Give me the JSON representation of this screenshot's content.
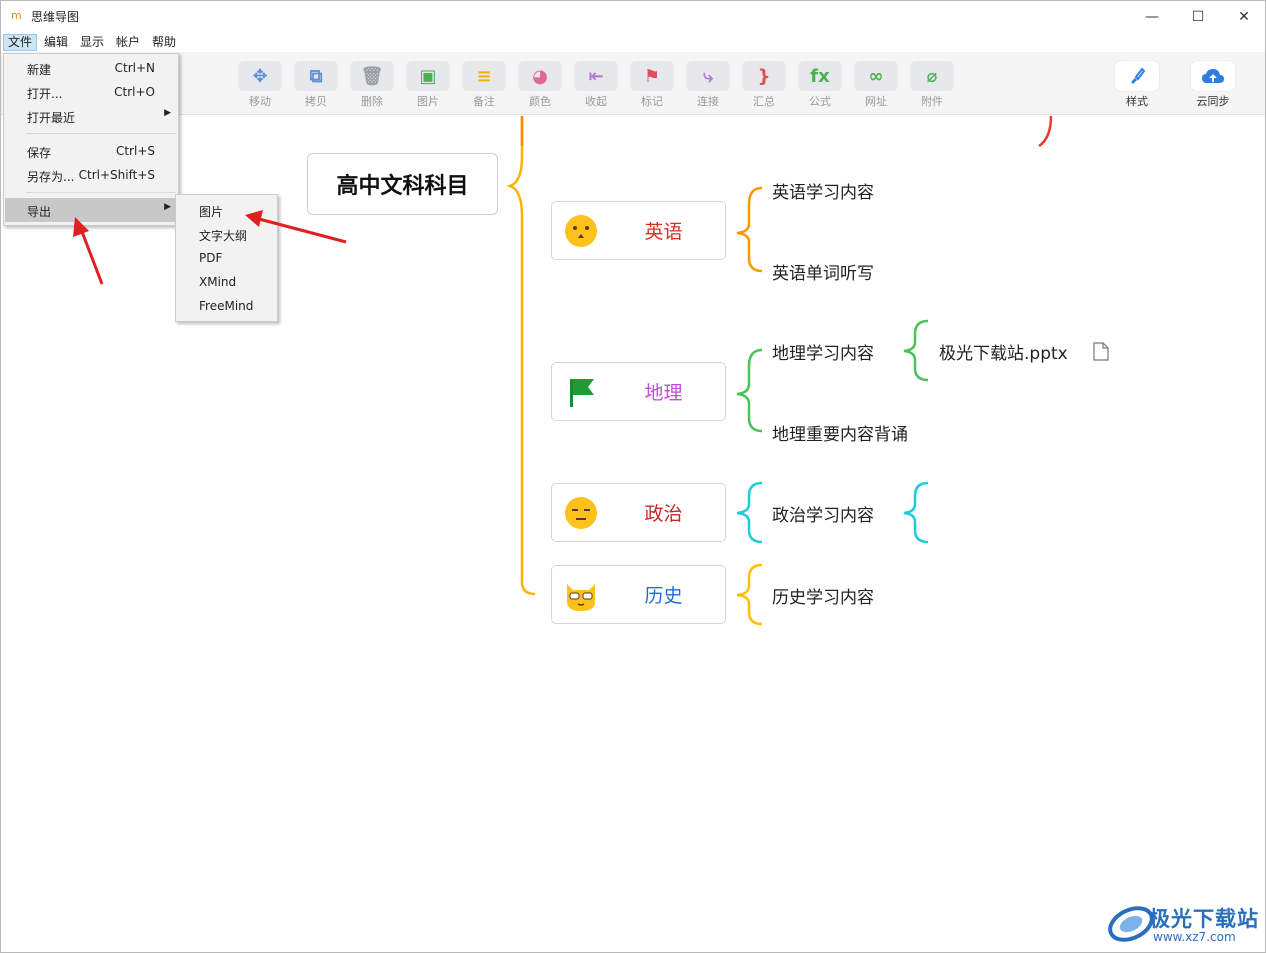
{
  "window": {
    "icon": "m",
    "title": "思维导图",
    "minimize": "—",
    "maximize": "☐",
    "close": "✕"
  },
  "menubar": {
    "items": [
      "文件",
      "编辑",
      "显示",
      "帐户",
      "帮助"
    ]
  },
  "toolbar": {
    "tools": [
      {
        "label": "移动",
        "icon": "move-icon",
        "glyph": "✥",
        "color": "#5b8fd6"
      },
      {
        "label": "拷贝",
        "icon": "copy-icon",
        "glyph": "⧉",
        "color": "#5b8fd6"
      },
      {
        "label": "删除",
        "icon": "trash-icon",
        "glyph": "🗑",
        "color": "#9aa0a6"
      },
      {
        "label": "图片",
        "icon": "image-icon",
        "glyph": "▣",
        "color": "#4caf50"
      },
      {
        "label": "备注",
        "icon": "note-icon",
        "glyph": "≡",
        "color": "#f0b400"
      },
      {
        "label": "颜色",
        "icon": "palette-icon",
        "glyph": "◕",
        "color": "#e06a8c"
      },
      {
        "label": "收起",
        "icon": "collapse-icon",
        "glyph": "⇤",
        "color": "#b07ad6"
      },
      {
        "label": "标记",
        "icon": "flag-icon",
        "glyph": "⚑",
        "color": "#e04f5f"
      },
      {
        "label": "连接",
        "icon": "connect-icon",
        "glyph": "⤷",
        "color": "#b07ad6"
      },
      {
        "label": "汇总",
        "icon": "summary-brace-icon",
        "glyph": "}",
        "color": "#e0504f"
      },
      {
        "label": "公式",
        "icon": "formula-icon",
        "glyph": "fx",
        "color": "#4caf50"
      },
      {
        "label": "网址",
        "icon": "link-icon",
        "glyph": "∞",
        "color": "#4caf50"
      },
      {
        "label": "附件",
        "icon": "paperclip-icon",
        "glyph": "⌀",
        "color": "#4caf50"
      }
    ],
    "right_tools": [
      {
        "label": "样式",
        "icon": "style-brush-icon",
        "glyph": "✎",
        "color": "#2f7de1"
      },
      {
        "label": "云同步",
        "icon": "cloud-upload-icon",
        "glyph": "☁",
        "color": "#2f7de1"
      }
    ]
  },
  "mindmap": {
    "root": "高中文科科目",
    "subjects": [
      {
        "name": "英语",
        "color": "#d93025",
        "emoji": "face-icon"
      },
      {
        "name": "地理",
        "color": "#c04fd6",
        "emoji": "green-flag-icon"
      },
      {
        "name": "政治",
        "color": "#c62828",
        "emoji": "face-icon"
      },
      {
        "name": "历史",
        "color": "#1e6fd9",
        "emoji": "cat-face-icon"
      }
    ],
    "leaves": {
      "english_1": "英语学习内容",
      "english_2": "英语单词听写",
      "geo_1": "地理学习内容",
      "geo_2": "地理重要内容背诵",
      "geo_attach": "极光下载站.pptx",
      "politics_1": "政治学习内容",
      "history_1": "历史学习内容"
    },
    "branch_colors": {
      "root": "#ffb300",
      "english": "#ff9800",
      "geo": "#4cc35a",
      "geo_sub": "#4cc35a",
      "politics": "#1ccde0",
      "history": "#ffc107",
      "top_cut": "#e53935"
    }
  },
  "file_menu": {
    "items": [
      {
        "label": "新建",
        "shortcut": "Ctrl+N"
      },
      {
        "label": "打开...",
        "shortcut": "Ctrl+O"
      },
      {
        "label": "打开最近",
        "shortcut": ""
      },
      {
        "label": "保存",
        "shortcut": "Ctrl+S"
      },
      {
        "label": "另存为...",
        "shortcut": "Ctrl+Shift+S"
      },
      {
        "label": "导出",
        "shortcut": ""
      }
    ],
    "submenu_arrow": "▶"
  },
  "export_submenu": {
    "items": [
      "图片",
      "文字大纲",
      "PDF",
      "XMind",
      "FreeMind"
    ]
  },
  "watermark": {
    "brand": "极光下载站",
    "url": "www.xz7.com"
  }
}
